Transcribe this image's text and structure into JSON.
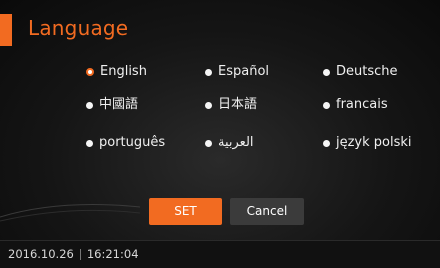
{
  "header": {
    "title": "Language"
  },
  "languages": [
    {
      "label": "English",
      "selected": true
    },
    {
      "label": "Español",
      "selected": false
    },
    {
      "label": "Deutsche",
      "selected": false
    },
    {
      "label": "中國語",
      "selected": false
    },
    {
      "label": "日本語",
      "selected": false
    },
    {
      "label": "francais",
      "selected": false
    },
    {
      "label": "português",
      "selected": false
    },
    {
      "label": "العربية",
      "selected": false
    },
    {
      "label": "język polski",
      "selected": false
    }
  ],
  "buttons": {
    "set": "SET",
    "cancel": "Cancel"
  },
  "status": {
    "date": "2016.10.26",
    "time": "16:21:04"
  },
  "colors": {
    "accent": "#f26b21",
    "cancel": "#3b3b3b"
  }
}
